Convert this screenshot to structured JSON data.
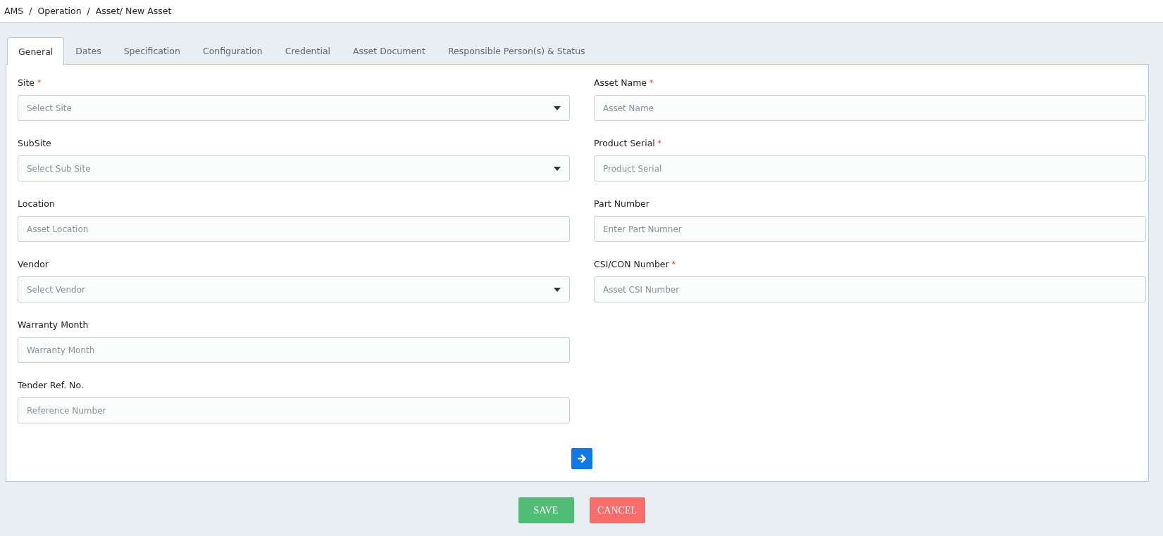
{
  "breadcrumb": "AMS  /  Operation  /  Asset/ New Asset",
  "tabs": [
    {
      "label": "General",
      "selected": true
    },
    {
      "label": "Dates",
      "selected": false
    },
    {
      "label": "Specification",
      "selected": false
    },
    {
      "label": "Configuration",
      "selected": false
    },
    {
      "label": "Credential",
      "selected": false
    },
    {
      "label": "Asset Document",
      "selected": false
    },
    {
      "label": "Responsible Person(s) & Status",
      "selected": false
    }
  ],
  "left_fields": [
    {
      "label": "Site",
      "required_mark": "*",
      "kind": "select",
      "placeholder": "Select Site"
    },
    {
      "label": "SubSite",
      "kind": "select",
      "placeholder": "Select Sub Site"
    },
    {
      "label": "Location",
      "kind": "text",
      "placeholder": "Asset Location"
    },
    {
      "label": "Vendor",
      "kind": "select",
      "placeholder": "Select Vendor"
    },
    {
      "label": "Warranty Month",
      "kind": "text",
      "placeholder": "Warranty Month"
    },
    {
      "label": "Tender Ref. No.",
      "kind": "text",
      "placeholder": "Reference Number"
    }
  ],
  "right_fields": [
    {
      "label": "Asset Name",
      "required_mark": "*",
      "kind": "text",
      "placeholder": "Asset Name"
    },
    {
      "label": "Product Serial",
      "required_mark": "*",
      "kind": "text",
      "placeholder": "Product Serial"
    },
    {
      "label": "Part Number",
      "kind": "text",
      "placeholder": "Enter Part Numner"
    },
    {
      "label": "CSI/CON Number",
      "required_mark": "*",
      "kind": "text",
      "placeholder": "Asset CSI Number"
    }
  ],
  "buttons": [
    {
      "label": "SAVE",
      "kind": "save"
    },
    {
      "label": "CANCEL",
      "kind": "cancel"
    }
  ]
}
